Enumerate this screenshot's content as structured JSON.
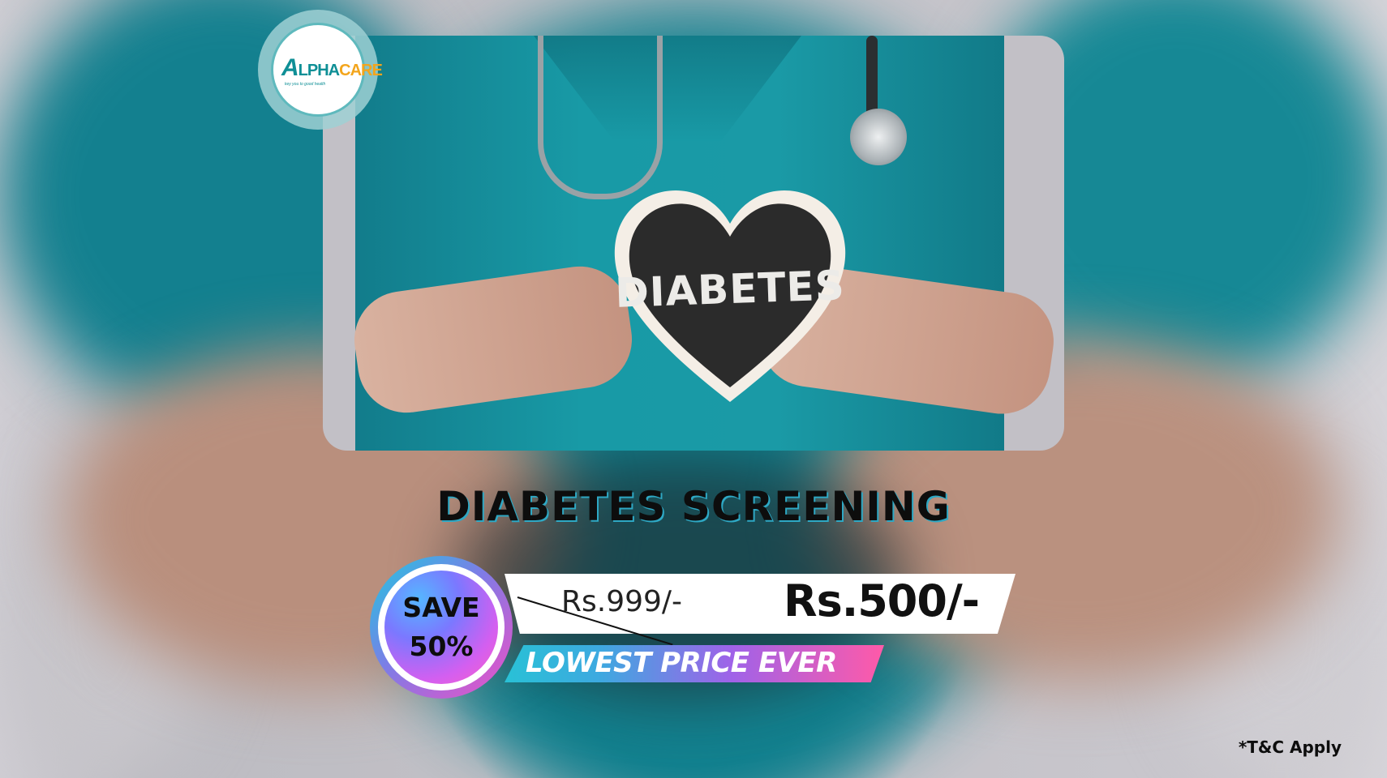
{
  "brand": {
    "logo_text_a": "A",
    "logo_text_lpha": "LPHA",
    "logo_text_care": "CARE",
    "tagline": "key you to good health"
  },
  "hero": {
    "sign_text": "DIABETES"
  },
  "offer": {
    "title": "DIABETES SCREENING",
    "old_price": "Rs.999/-",
    "new_price": "Rs.500/-",
    "ribbon": "LOWEST PRICE EVER",
    "badge_line1": "SAVE",
    "badge_line2": "50%",
    "discount_percent": 50
  },
  "footer": {
    "terms": "*T&C Apply"
  },
  "colors": {
    "scrub_teal": "#189aa6",
    "accent_cyan": "#29c1d6",
    "accent_pink": "#ff5aa8",
    "logo_teal": "#0f8f96",
    "logo_orange": "#f3a51c"
  }
}
